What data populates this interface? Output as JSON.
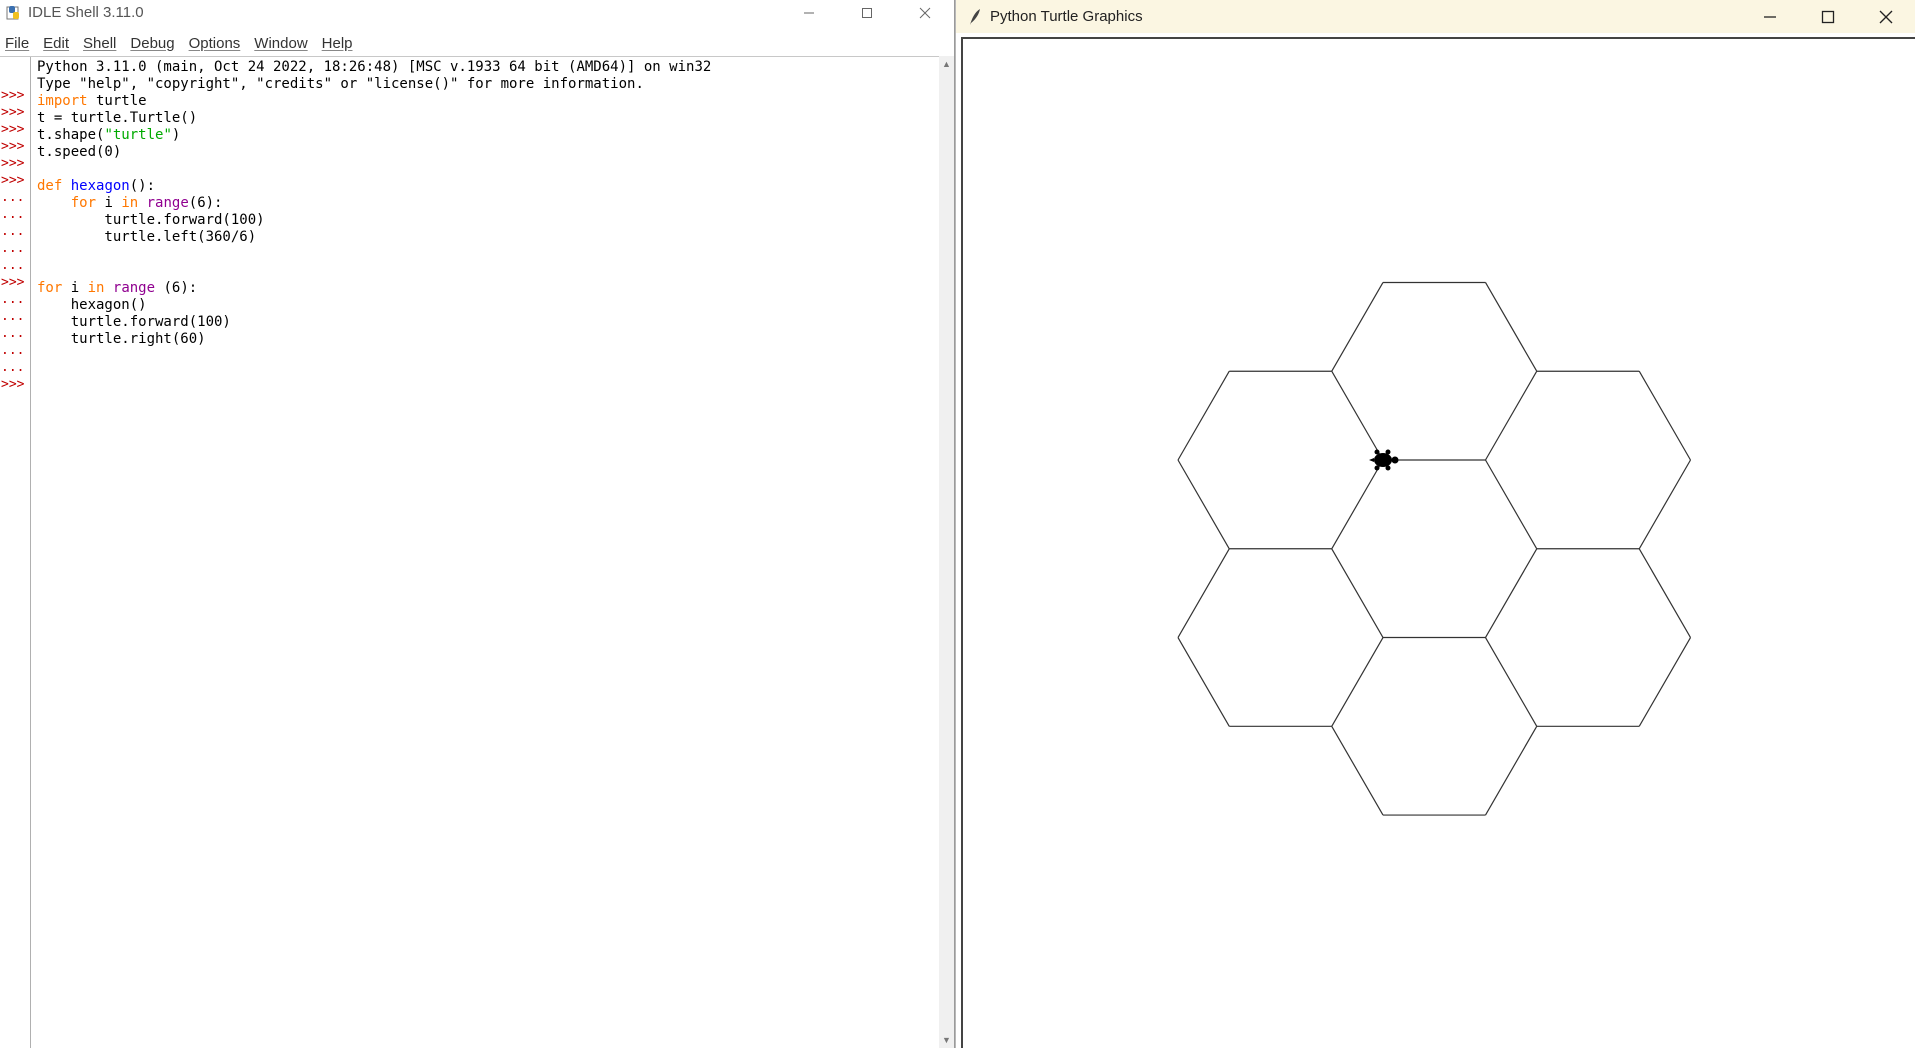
{
  "idle": {
    "title": "IDLE Shell 3.11.0",
    "menu": [
      "File",
      "Edit",
      "Shell",
      "Debug",
      "Options",
      "Window",
      "Help"
    ],
    "prompts": [
      ">>>",
      ">>>",
      ">>>",
      ">>>",
      ">>>",
      ">>>",
      "...",
      "...",
      "...",
      "...",
      "...",
      ">>>",
      "...",
      "...",
      "...",
      "...",
      "...",
      ">>>"
    ],
    "lines": [
      "Python 3.11.0 (main, Oct 24 2022, 18:26:48) [MSC v.1933 64 bit (AMD64)] on win32",
      "Type \"help\", \"copyright\", \"credits\" or \"license()\" for more information.",
      "import turtle",
      "t = turtle.Turtle()",
      "t.shape(\"turtle\")",
      "t.speed(0)",
      "",
      "def hexagon():",
      "    for i in range(6):",
      "        turtle.forward(100)",
      "        turtle.left(360/6)",
      "",
      "",
      "for i in range (6):",
      "    hexagon()",
      "    turtle.forward(100)",
      "    turtle.right(60)"
    ]
  },
  "turtle_window": {
    "title": "Python Turtle Graphics"
  },
  "colors": {
    "prompt": "#c00000",
    "keyword": "#ff7700",
    "builtin": "#900090",
    "string": "#00aa00",
    "definition": "#0000ff",
    "turtle_titlebar": "#fbf6e2"
  },
  "icons": {
    "minimize": "minimize-icon",
    "maximize": "maximize-icon",
    "close": "close-icon",
    "idle_app": "python-idle-icon",
    "turtle_app": "feather-icon"
  }
}
